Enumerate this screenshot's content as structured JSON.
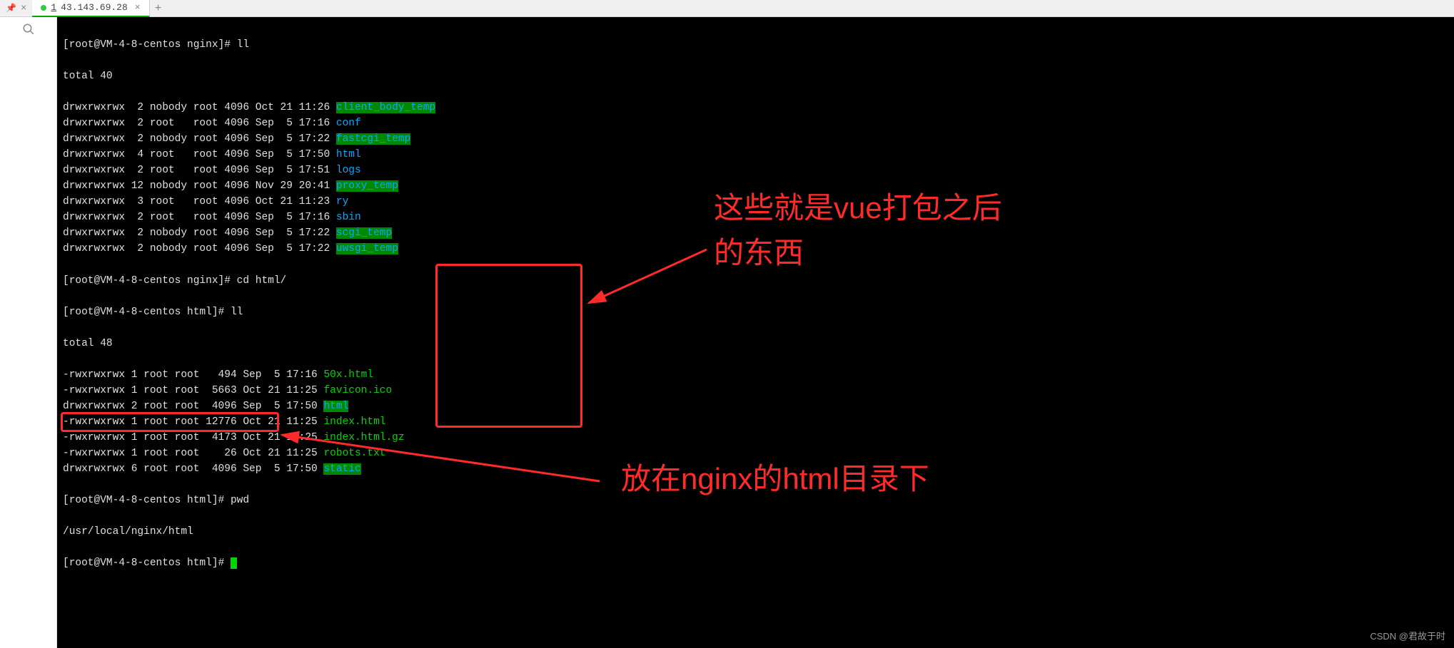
{
  "tab": {
    "num": "1",
    "ip": "43.143.69.28",
    "close": "×"
  },
  "prompt1": "[root@VM-4-8-centos nginx]# ll",
  "total1": "total 40",
  "nginx_listing": [
    {
      "perm": "drwxrwxrwx",
      "links": " 2",
      "owner": "nobody",
      "group": "root",
      "size": "4096",
      "date": "Oct 21 11:26",
      "name": "client_body_temp",
      "cls": "green-bg"
    },
    {
      "perm": "drwxrwxrwx",
      "links": " 2",
      "owner": "root  ",
      "group": "root",
      "size": "4096",
      "date": "Sep  5 17:16",
      "name": "conf",
      "cls": "blue"
    },
    {
      "perm": "drwxrwxrwx",
      "links": " 2",
      "owner": "nobody",
      "group": "root",
      "size": "4096",
      "date": "Sep  5 17:22",
      "name": "fastcgi_temp",
      "cls": "green-bg"
    },
    {
      "perm": "drwxrwxrwx",
      "links": " 4",
      "owner": "root  ",
      "group": "root",
      "size": "4096",
      "date": "Sep  5 17:50",
      "name": "html",
      "cls": "blue"
    },
    {
      "perm": "drwxrwxrwx",
      "links": " 2",
      "owner": "root  ",
      "group": "root",
      "size": "4096",
      "date": "Sep  5 17:51",
      "name": "logs",
      "cls": "blue"
    },
    {
      "perm": "drwxrwxrwx",
      "links": "12",
      "owner": "nobody",
      "group": "root",
      "size": "4096",
      "date": "Nov 29 20:41",
      "name": "proxy_temp",
      "cls": "green-bg"
    },
    {
      "perm": "drwxrwxrwx",
      "links": " 3",
      "owner": "root  ",
      "group": "root",
      "size": "4096",
      "date": "Oct 21 11:23",
      "name": "ry",
      "cls": "blue"
    },
    {
      "perm": "drwxrwxrwx",
      "links": " 2",
      "owner": "root  ",
      "group": "root",
      "size": "4096",
      "date": "Sep  5 17:16",
      "name": "sbin",
      "cls": "blue"
    },
    {
      "perm": "drwxrwxrwx",
      "links": " 2",
      "owner": "nobody",
      "group": "root",
      "size": "4096",
      "date": "Sep  5 17:22",
      "name": "scgi_temp",
      "cls": "green-bg"
    },
    {
      "perm": "drwxrwxrwx",
      "links": " 2",
      "owner": "nobody",
      "group": "root",
      "size": "4096",
      "date": "Sep  5 17:22",
      "name": "uwsgi_temp",
      "cls": "green-bg"
    }
  ],
  "prompt2": "[root@VM-4-8-centos nginx]# cd html/",
  "prompt3": "[root@VM-4-8-centos html]# ll",
  "total2": "total 48",
  "html_listing": [
    {
      "perm": "-rwxrwxrwx",
      "links": "1",
      "owner": "root",
      "group": "root",
      "size": "  494",
      "date": "Sep  5 17:16",
      "name": "50x.html",
      "cls": "green"
    },
    {
      "perm": "-rwxrwxrwx",
      "links": "1",
      "owner": "root",
      "group": "root",
      "size": " 5663",
      "date": "Oct 21 11:25",
      "name": "favicon.ico",
      "cls": "green"
    },
    {
      "perm": "drwxrwxrwx",
      "links": "2",
      "owner": "root",
      "group": "root",
      "size": " 4096",
      "date": "Sep  5 17:50",
      "name": "html",
      "cls": "green-bg"
    },
    {
      "perm": "-rwxrwxrwx",
      "links": "1",
      "owner": "root",
      "group": "root",
      "size": "12776",
      "date": "Oct 21 11:25",
      "name": "index.html",
      "cls": "green"
    },
    {
      "perm": "-rwxrwxrwx",
      "links": "1",
      "owner": "root",
      "group": "root",
      "size": " 4173",
      "date": "Oct 21 11:25",
      "name": "index.html.gz",
      "cls": "green"
    },
    {
      "perm": "-rwxrwxrwx",
      "links": "1",
      "owner": "root",
      "group": "root",
      "size": "   26",
      "date": "Oct 21 11:25",
      "name": "robots.txt",
      "cls": "green"
    },
    {
      "perm": "drwxrwxrwx",
      "links": "6",
      "owner": "root",
      "group": "root",
      "size": " 4096",
      "date": "Sep  5 17:50",
      "name": "static",
      "cls": "green-bg"
    }
  ],
  "prompt4": "[root@VM-4-8-centos html]# pwd",
  "pwd_out": "/usr/local/nginx/html",
  "prompt5": "[root@VM-4-8-centos html]# ",
  "annotation1": "这些就是vue打包之后\n的东西",
  "annotation2": "放在nginx的html目录下",
  "watermark": "CSDN @君故于时"
}
